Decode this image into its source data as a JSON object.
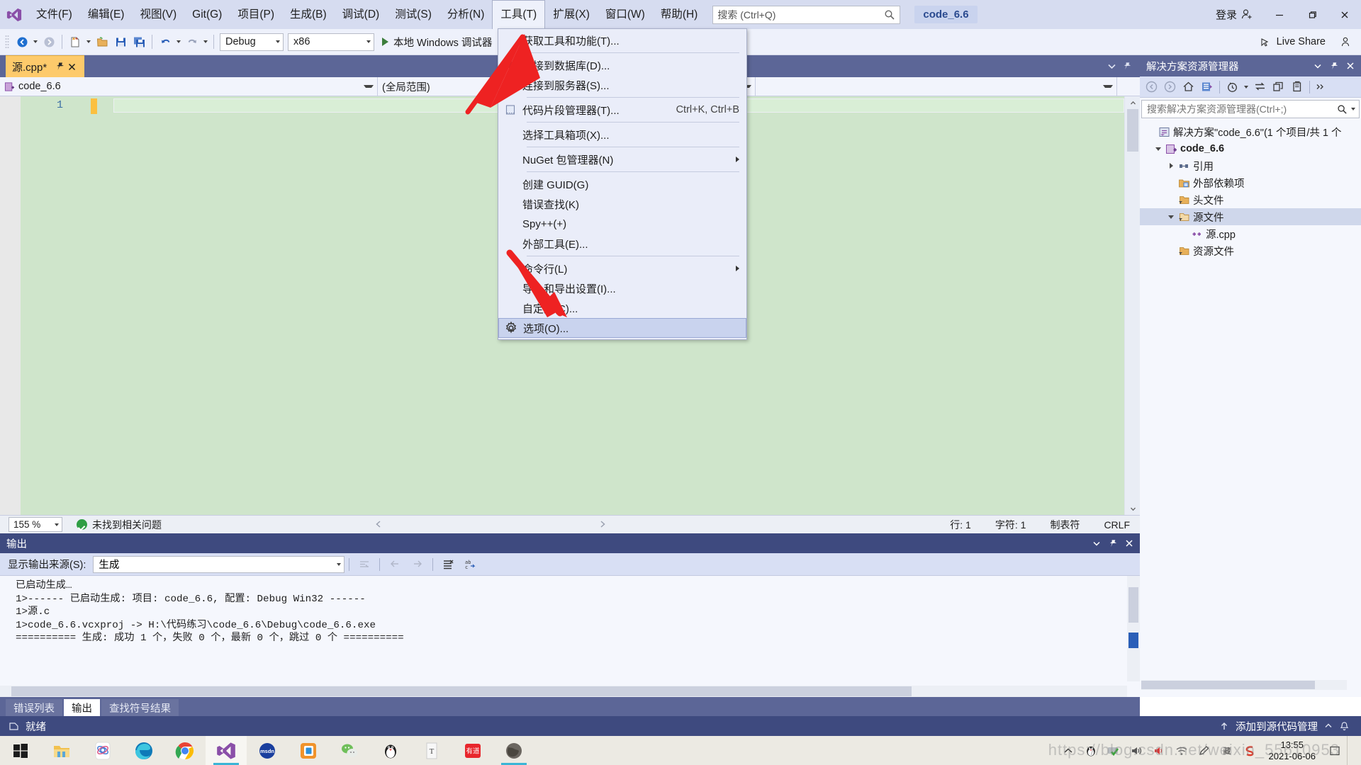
{
  "titlebar": {
    "menus": [
      {
        "label": "文件(F)",
        "name": "menu-file"
      },
      {
        "label": "编辑(E)",
        "name": "menu-edit"
      },
      {
        "label": "视图(V)",
        "name": "menu-view"
      },
      {
        "label": "Git(G)",
        "name": "menu-git"
      },
      {
        "label": "项目(P)",
        "name": "menu-project"
      },
      {
        "label": "生成(B)",
        "name": "menu-build"
      },
      {
        "label": "调试(D)",
        "name": "menu-debug"
      },
      {
        "label": "测试(S)",
        "name": "menu-test"
      },
      {
        "label": "分析(N)",
        "name": "menu-analyze"
      },
      {
        "label": "工具(T)",
        "name": "menu-tools"
      },
      {
        "label": "扩展(X)",
        "name": "menu-extensions"
      },
      {
        "label": "窗口(W)",
        "name": "menu-window"
      },
      {
        "label": "帮助(H)",
        "name": "menu-help"
      }
    ],
    "search_placeholder": "搜索 (Ctrl+Q)",
    "search_value": "",
    "solution_chip": "code_6.6",
    "signin_label": "登录"
  },
  "toolbar": {
    "config": "Debug",
    "platform": "x86",
    "run_label": "本地 Windows 调试器",
    "live_share": "Live Share"
  },
  "document_tab": {
    "title": "源.cpp*"
  },
  "navbar": {
    "scope": "code_6.6",
    "type": "(全局范围)",
    "member": ""
  },
  "editor": {
    "line_number": "1",
    "code": ""
  },
  "editor_status": {
    "zoom": "155 %",
    "issues": "未找到相关问题",
    "line": "行: 1",
    "col": "字符: 1",
    "indent": "制表符",
    "eol": "CRLF"
  },
  "solution_explorer": {
    "title": "解决方案资源管理器",
    "search_placeholder": "搜索解决方案资源管理器(Ctrl+;)",
    "search_value": "",
    "tree": [
      {
        "label": "解决方案\"code_6.6\"(1 个项目/共 1 个",
        "indent": 0,
        "icon": "solution-icon",
        "expander": "none",
        "bold": false,
        "selected": false,
        "name": "tree-node-solution"
      },
      {
        "label": "code_6.6",
        "indent": 1,
        "icon": "cpp-project-icon",
        "expander": "down",
        "bold": true,
        "selected": false,
        "name": "tree-node-project"
      },
      {
        "label": "引用",
        "indent": 2,
        "icon": "references-icon",
        "expander": "right",
        "bold": false,
        "selected": false,
        "name": "tree-node-references"
      },
      {
        "label": "外部依赖项",
        "indent": 2,
        "icon": "external-deps-icon",
        "expander": "none",
        "bold": false,
        "selected": false,
        "name": "tree-node-external-dependencies"
      },
      {
        "label": "头文件",
        "indent": 2,
        "icon": "folder-filter-icon",
        "expander": "none",
        "bold": false,
        "selected": false,
        "name": "tree-node-header-files"
      },
      {
        "label": "源文件",
        "indent": 2,
        "icon": "folder-open-filter-icon",
        "expander": "down",
        "bold": false,
        "selected": true,
        "name": "tree-node-source-files"
      },
      {
        "label": "源.cpp",
        "indent": 3,
        "icon": "cpp-file-icon",
        "expander": "none",
        "bold": false,
        "selected": false,
        "name": "tree-node-source-cpp"
      },
      {
        "label": "资源文件",
        "indent": 2,
        "icon": "folder-filter-icon",
        "expander": "none",
        "bold": false,
        "selected": false,
        "name": "tree-node-resource-files"
      }
    ]
  },
  "output_panel": {
    "title": "输出",
    "source_label": "显示输出来源(S):",
    "source_value": "生成",
    "lines": [
      "已启动生成…",
      "1>------ 已启动生成: 项目: code_6.6, 配置: Debug Win32 ------",
      "1>源.c",
      "1>code_6.6.vcxproj -> H:\\代码练习\\code_6.6\\Debug\\code_6.6.exe",
      "========== 生成: 成功 1 个，失败 0 个，最新 0 个，跳过 0 个 =========="
    ]
  },
  "bottom_tabs": [
    {
      "label": "错误列表",
      "active": false,
      "name": "tab-error-list"
    },
    {
      "label": "输出",
      "active": true,
      "name": "tab-output"
    },
    {
      "label": "查找符号结果",
      "active": false,
      "name": "tab-find-symbol-results"
    }
  ],
  "vs_status": {
    "ready": "就绪",
    "source_control": "添加到源代码管理"
  },
  "tools_menu": {
    "items": [
      {
        "label": "获取工具和功能(T)...",
        "icon": "none",
        "shortcut": "",
        "submenu": false,
        "sep_after": true,
        "name": "menu-get-tools-and-features"
      },
      {
        "label": "连接到数据库(D)...",
        "icon": "database-connect-icon",
        "shortcut": "",
        "submenu": false,
        "sep_after": false,
        "name": "menu-connect-to-database"
      },
      {
        "label": "连接到服务器(S)...",
        "icon": "server-connect-icon",
        "shortcut": "",
        "submenu": false,
        "sep_after": true,
        "name": "menu-connect-to-server"
      },
      {
        "label": "代码片段管理器(T)...",
        "icon": "snippet-icon",
        "shortcut": "Ctrl+K, Ctrl+B",
        "submenu": false,
        "sep_after": true,
        "name": "menu-code-snippets-manager"
      },
      {
        "label": "选择工具箱项(X)...",
        "icon": "none",
        "shortcut": "",
        "submenu": false,
        "sep_after": true,
        "name": "menu-choose-toolbox-items"
      },
      {
        "label": "NuGet 包管理器(N)",
        "icon": "none",
        "shortcut": "",
        "submenu": true,
        "sep_after": true,
        "name": "menu-nuget-package-manager"
      },
      {
        "label": "创建 GUID(G)",
        "icon": "none",
        "shortcut": "",
        "submenu": false,
        "sep_after": false,
        "name": "menu-create-guid"
      },
      {
        "label": "错误查找(K)",
        "icon": "none",
        "shortcut": "",
        "submenu": false,
        "sep_after": false,
        "name": "menu-error-lookup"
      },
      {
        "label": "Spy++(+)",
        "icon": "none",
        "shortcut": "",
        "submenu": false,
        "sep_after": false,
        "name": "menu-spy-plus-plus"
      },
      {
        "label": "外部工具(E)...",
        "icon": "none",
        "shortcut": "",
        "submenu": false,
        "sep_after": true,
        "name": "menu-external-tools"
      },
      {
        "label": "命令行(L)",
        "icon": "none",
        "shortcut": "",
        "submenu": true,
        "sep_after": false,
        "name": "menu-command-line"
      },
      {
        "label": "导入和导出设置(I)...",
        "icon": "none",
        "shortcut": "",
        "submenu": false,
        "sep_after": false,
        "name": "menu-import-export-settings"
      },
      {
        "label": "自定义(C)...",
        "icon": "none",
        "shortcut": "",
        "submenu": false,
        "sep_after": false,
        "name": "menu-customize"
      },
      {
        "label": "选项(O)...",
        "icon": "gear-icon",
        "shortcut": "",
        "submenu": false,
        "sep_after": false,
        "highlight": true,
        "name": "menu-options"
      }
    ]
  },
  "taskbar": {
    "apps": [
      {
        "name": "taskbar-file-explorer",
        "icon": "folder"
      },
      {
        "name": "taskbar-atom",
        "icon": "atom"
      },
      {
        "name": "taskbar-edge",
        "icon": "edge",
        "running": true
      },
      {
        "name": "taskbar-chrome",
        "icon": "chrome",
        "running": true
      },
      {
        "name": "taskbar-visual-studio",
        "icon": "vs",
        "running": true,
        "active": true
      },
      {
        "name": "taskbar-msdn",
        "icon": "msdn"
      },
      {
        "name": "taskbar-vmware",
        "icon": "vmware"
      },
      {
        "name": "taskbar-wechat",
        "icon": "wechat"
      },
      {
        "name": "taskbar-qq",
        "icon": "qq"
      },
      {
        "name": "taskbar-typora",
        "icon": "typora"
      },
      {
        "name": "taskbar-youdao",
        "icon": "youdao"
      },
      {
        "name": "taskbar-earth",
        "icon": "earth",
        "running": true
      }
    ],
    "clock_time": "13:55",
    "clock_date": "2021-06-06"
  },
  "watermark": "https://blog.csdn.net/weixin_55610953",
  "colors": {
    "title_bg": "#d6dcf0",
    "accent_tab": "#fdca6b",
    "panel_header": "#3e4a7f",
    "tabstrip_bg": "#5c6697",
    "editor_bg": "#cfe5cb",
    "menu_bg": "#eaedf9",
    "menu_highlight": "#c9d3ee",
    "arrow_red": "#ee2222"
  }
}
